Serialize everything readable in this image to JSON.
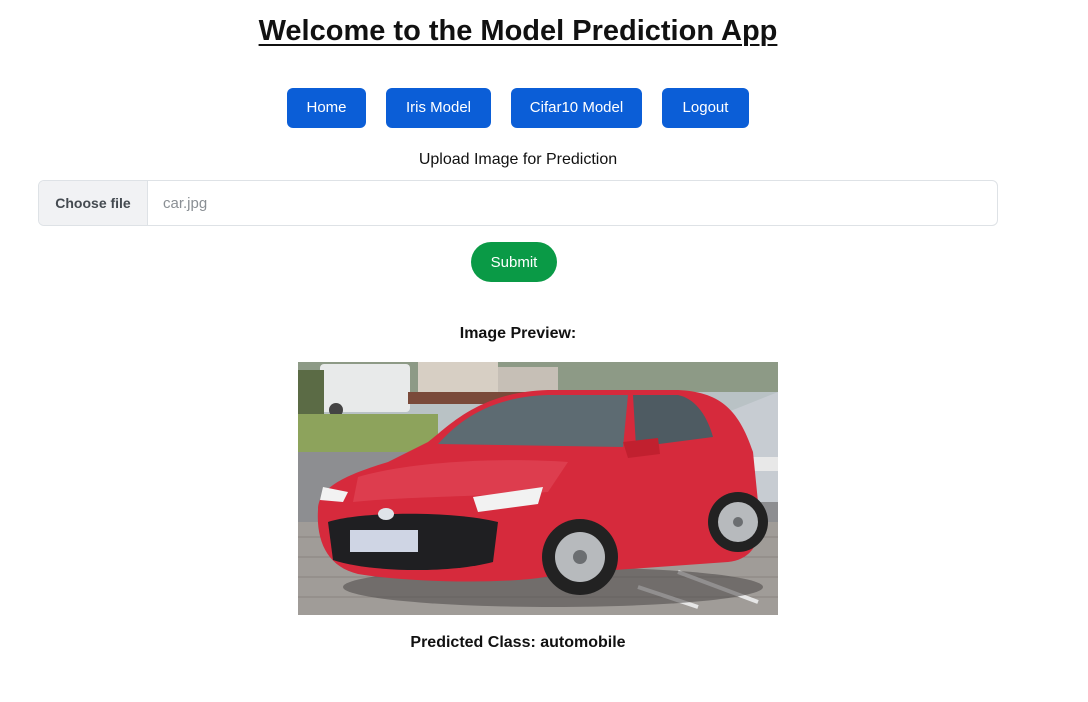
{
  "header": {
    "title": "Welcome to the Model Prediction App"
  },
  "nav": {
    "items": [
      {
        "label": "Home"
      },
      {
        "label": "Iris Model"
      },
      {
        "label": "Cifar10 Model"
      },
      {
        "label": "Logout"
      }
    ],
    "button_color": "#0b5ed7"
  },
  "upload": {
    "label": "Upload Image for Prediction",
    "choose_button": "Choose file",
    "file_name": "car.jpg",
    "submit_label": "Submit",
    "submit_color": "#0a9a46"
  },
  "preview": {
    "heading": "Image Preview:",
    "image_subject": "red-hatchback-car-photo"
  },
  "result": {
    "text": "Predicted Class: automobile"
  }
}
